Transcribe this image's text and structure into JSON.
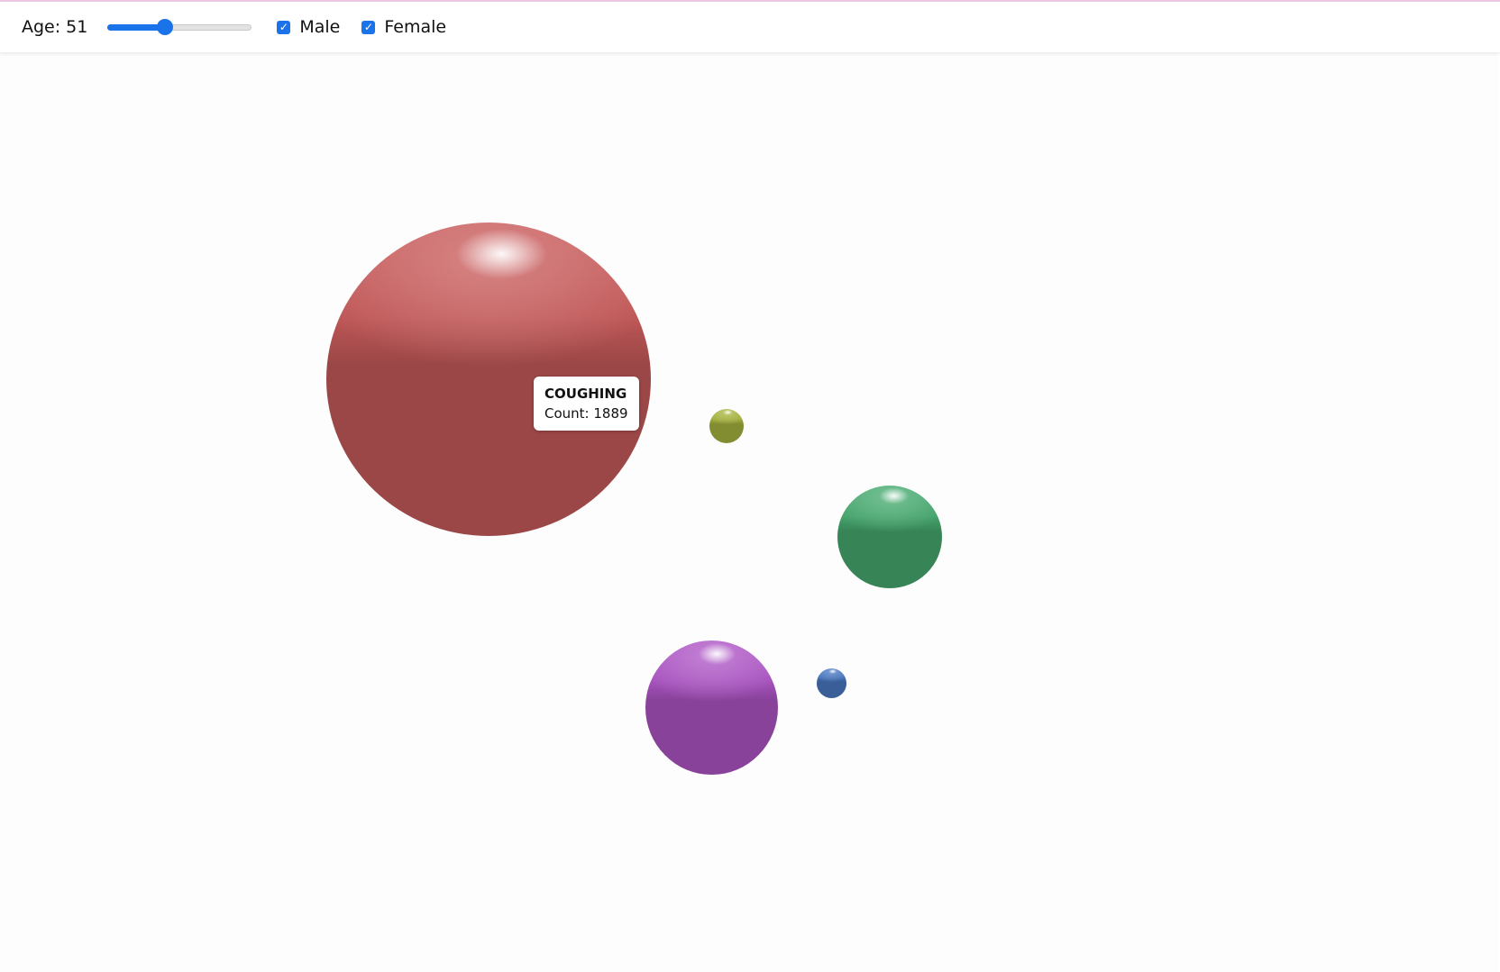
{
  "controls": {
    "age_label": "Age:",
    "age_value": "51",
    "age_slider_fraction": 0.4,
    "male_label": "Male",
    "male_checked": true,
    "female_label": "Female",
    "female_checked": true
  },
  "colors": {
    "accent": "#1a73e8",
    "top_line": "#ecc9e6"
  },
  "bubbles": [
    {
      "name": "coughing",
      "color": "#c85b5b"
    },
    {
      "name": "yellow",
      "color": "#a7b43e"
    },
    {
      "name": "green",
      "color": "#46a96f"
    },
    {
      "name": "purple",
      "color": "#ae55c6"
    },
    {
      "name": "blue",
      "color": "#4a78c2"
    }
  ],
  "tooltip": {
    "title": "COUGHING",
    "count_label": "Count:",
    "count_value": "1889"
  }
}
